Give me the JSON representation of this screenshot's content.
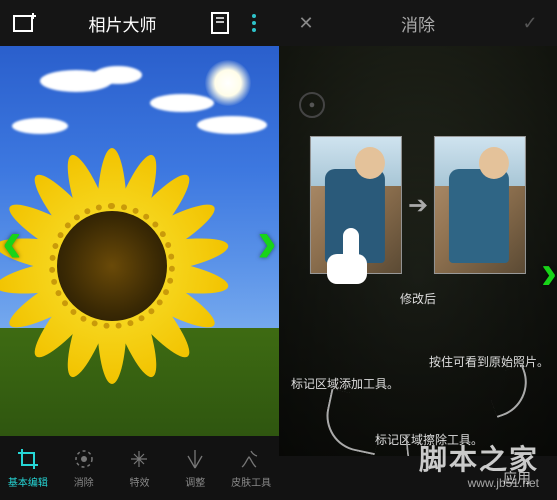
{
  "left": {
    "title": "相片大师",
    "nav_prev": "‹",
    "nav_next": "›",
    "toolbar": [
      {
        "label": "基本编辑",
        "icon": "crop-icon",
        "active": true
      },
      {
        "label": "消除",
        "icon": "erase-icon",
        "active": false
      },
      {
        "label": "特效",
        "icon": "sparkle-icon",
        "active": false
      },
      {
        "label": "调整",
        "icon": "tune-icon",
        "active": false
      },
      {
        "label": "皮肤工具",
        "icon": "skin-icon",
        "active": false
      }
    ]
  },
  "right": {
    "title": "消除",
    "close": "✕",
    "confirm": "✓",
    "after_label": "修改后",
    "tip_add": "标记区域添加工具。",
    "tip_erase": "标记区域擦除工具。",
    "tip_original": "按住可看到原始照片。",
    "apply": "应用"
  },
  "watermark": {
    "brand": "脚本之家",
    "url": "www.jb51.net"
  },
  "colors": {
    "accent": "#26d6d6",
    "nav": "#18d418"
  }
}
